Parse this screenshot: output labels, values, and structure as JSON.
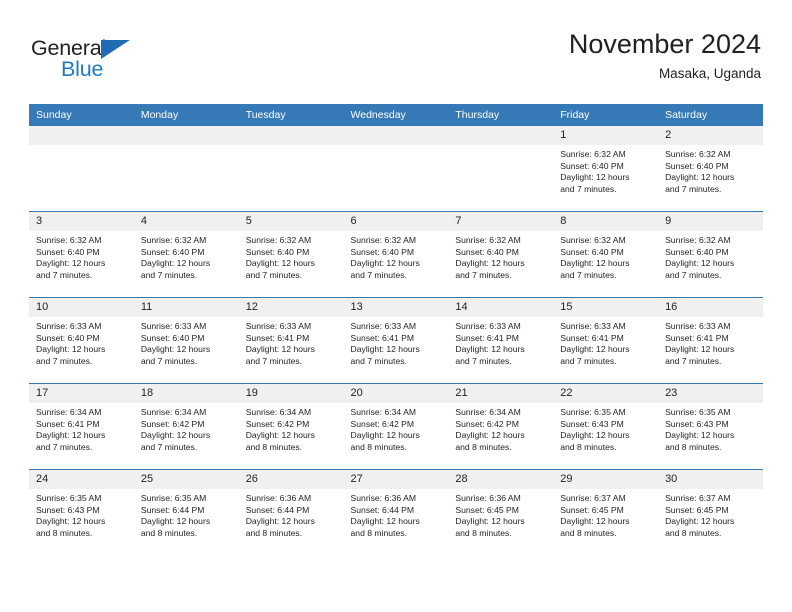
{
  "logo": {
    "word1": "General",
    "word2": "Blue",
    "triangle_color": "#1f6cb4",
    "blue_color": "#1f7bc4"
  },
  "header": {
    "title": "November 2024",
    "subtitle": "Masaka, Uganda"
  },
  "theme": {
    "header_blue": "#3679b7",
    "daynum_gray": "#f0f0f0",
    "text": "#231f20"
  },
  "weekday_headers": [
    "Sunday",
    "Monday",
    "Tuesday",
    "Wednesday",
    "Thursday",
    "Friday",
    "Saturday"
  ],
  "weeks": [
    [
      {
        "day": "",
        "lines": []
      },
      {
        "day": "",
        "lines": []
      },
      {
        "day": "",
        "lines": []
      },
      {
        "day": "",
        "lines": []
      },
      {
        "day": "",
        "lines": []
      },
      {
        "day": "1",
        "lines": [
          "Sunrise: 6:32 AM",
          "Sunset: 6:40 PM",
          "Daylight: 12 hours",
          "and 7 minutes."
        ]
      },
      {
        "day": "2",
        "lines": [
          "Sunrise: 6:32 AM",
          "Sunset: 6:40 PM",
          "Daylight: 12 hours",
          "and 7 minutes."
        ]
      }
    ],
    [
      {
        "day": "3",
        "lines": [
          "Sunrise: 6:32 AM",
          "Sunset: 6:40 PM",
          "Daylight: 12 hours",
          "and 7 minutes."
        ]
      },
      {
        "day": "4",
        "lines": [
          "Sunrise: 6:32 AM",
          "Sunset: 6:40 PM",
          "Daylight: 12 hours",
          "and 7 minutes."
        ]
      },
      {
        "day": "5",
        "lines": [
          "Sunrise: 6:32 AM",
          "Sunset: 6:40 PM",
          "Daylight: 12 hours",
          "and 7 minutes."
        ]
      },
      {
        "day": "6",
        "lines": [
          "Sunrise: 6:32 AM",
          "Sunset: 6:40 PM",
          "Daylight: 12 hours",
          "and 7 minutes."
        ]
      },
      {
        "day": "7",
        "lines": [
          "Sunrise: 6:32 AM",
          "Sunset: 6:40 PM",
          "Daylight: 12 hours",
          "and 7 minutes."
        ]
      },
      {
        "day": "8",
        "lines": [
          "Sunrise: 6:32 AM",
          "Sunset: 6:40 PM",
          "Daylight: 12 hours",
          "and 7 minutes."
        ]
      },
      {
        "day": "9",
        "lines": [
          "Sunrise: 6:32 AM",
          "Sunset: 6:40 PM",
          "Daylight: 12 hours",
          "and 7 minutes."
        ]
      }
    ],
    [
      {
        "day": "10",
        "lines": [
          "Sunrise: 6:33 AM",
          "Sunset: 6:40 PM",
          "Daylight: 12 hours",
          "and 7 minutes."
        ]
      },
      {
        "day": "11",
        "lines": [
          "Sunrise: 6:33 AM",
          "Sunset: 6:40 PM",
          "Daylight: 12 hours",
          "and 7 minutes."
        ]
      },
      {
        "day": "12",
        "lines": [
          "Sunrise: 6:33 AM",
          "Sunset: 6:41 PM",
          "Daylight: 12 hours",
          "and 7 minutes."
        ]
      },
      {
        "day": "13",
        "lines": [
          "Sunrise: 6:33 AM",
          "Sunset: 6:41 PM",
          "Daylight: 12 hours",
          "and 7 minutes."
        ]
      },
      {
        "day": "14",
        "lines": [
          "Sunrise: 6:33 AM",
          "Sunset: 6:41 PM",
          "Daylight: 12 hours",
          "and 7 minutes."
        ]
      },
      {
        "day": "15",
        "lines": [
          "Sunrise: 6:33 AM",
          "Sunset: 6:41 PM",
          "Daylight: 12 hours",
          "and 7 minutes."
        ]
      },
      {
        "day": "16",
        "lines": [
          "Sunrise: 6:33 AM",
          "Sunset: 6:41 PM",
          "Daylight: 12 hours",
          "and 7 minutes."
        ]
      }
    ],
    [
      {
        "day": "17",
        "lines": [
          "Sunrise: 6:34 AM",
          "Sunset: 6:41 PM",
          "Daylight: 12 hours",
          "and 7 minutes."
        ]
      },
      {
        "day": "18",
        "lines": [
          "Sunrise: 6:34 AM",
          "Sunset: 6:42 PM",
          "Daylight: 12 hours",
          "and 7 minutes."
        ]
      },
      {
        "day": "19",
        "lines": [
          "Sunrise: 6:34 AM",
          "Sunset: 6:42 PM",
          "Daylight: 12 hours",
          "and 8 minutes."
        ]
      },
      {
        "day": "20",
        "lines": [
          "Sunrise: 6:34 AM",
          "Sunset: 6:42 PM",
          "Daylight: 12 hours",
          "and 8 minutes."
        ]
      },
      {
        "day": "21",
        "lines": [
          "Sunrise: 6:34 AM",
          "Sunset: 6:42 PM",
          "Daylight: 12 hours",
          "and 8 minutes."
        ]
      },
      {
        "day": "22",
        "lines": [
          "Sunrise: 6:35 AM",
          "Sunset: 6:43 PM",
          "Daylight: 12 hours",
          "and 8 minutes."
        ]
      },
      {
        "day": "23",
        "lines": [
          "Sunrise: 6:35 AM",
          "Sunset: 6:43 PM",
          "Daylight: 12 hours",
          "and 8 minutes."
        ]
      }
    ],
    [
      {
        "day": "24",
        "lines": [
          "Sunrise: 6:35 AM",
          "Sunset: 6:43 PM",
          "Daylight: 12 hours",
          "and 8 minutes."
        ]
      },
      {
        "day": "25",
        "lines": [
          "Sunrise: 6:35 AM",
          "Sunset: 6:44 PM",
          "Daylight: 12 hours",
          "and 8 minutes."
        ]
      },
      {
        "day": "26",
        "lines": [
          "Sunrise: 6:36 AM",
          "Sunset: 6:44 PM",
          "Daylight: 12 hours",
          "and 8 minutes."
        ]
      },
      {
        "day": "27",
        "lines": [
          "Sunrise: 6:36 AM",
          "Sunset: 6:44 PM",
          "Daylight: 12 hours",
          "and 8 minutes."
        ]
      },
      {
        "day": "28",
        "lines": [
          "Sunrise: 6:36 AM",
          "Sunset: 6:45 PM",
          "Daylight: 12 hours",
          "and 8 minutes."
        ]
      },
      {
        "day": "29",
        "lines": [
          "Sunrise: 6:37 AM",
          "Sunset: 6:45 PM",
          "Daylight: 12 hours",
          "and 8 minutes."
        ]
      },
      {
        "day": "30",
        "lines": [
          "Sunrise: 6:37 AM",
          "Sunset: 6:45 PM",
          "Daylight: 12 hours",
          "and 8 minutes."
        ]
      }
    ]
  ]
}
